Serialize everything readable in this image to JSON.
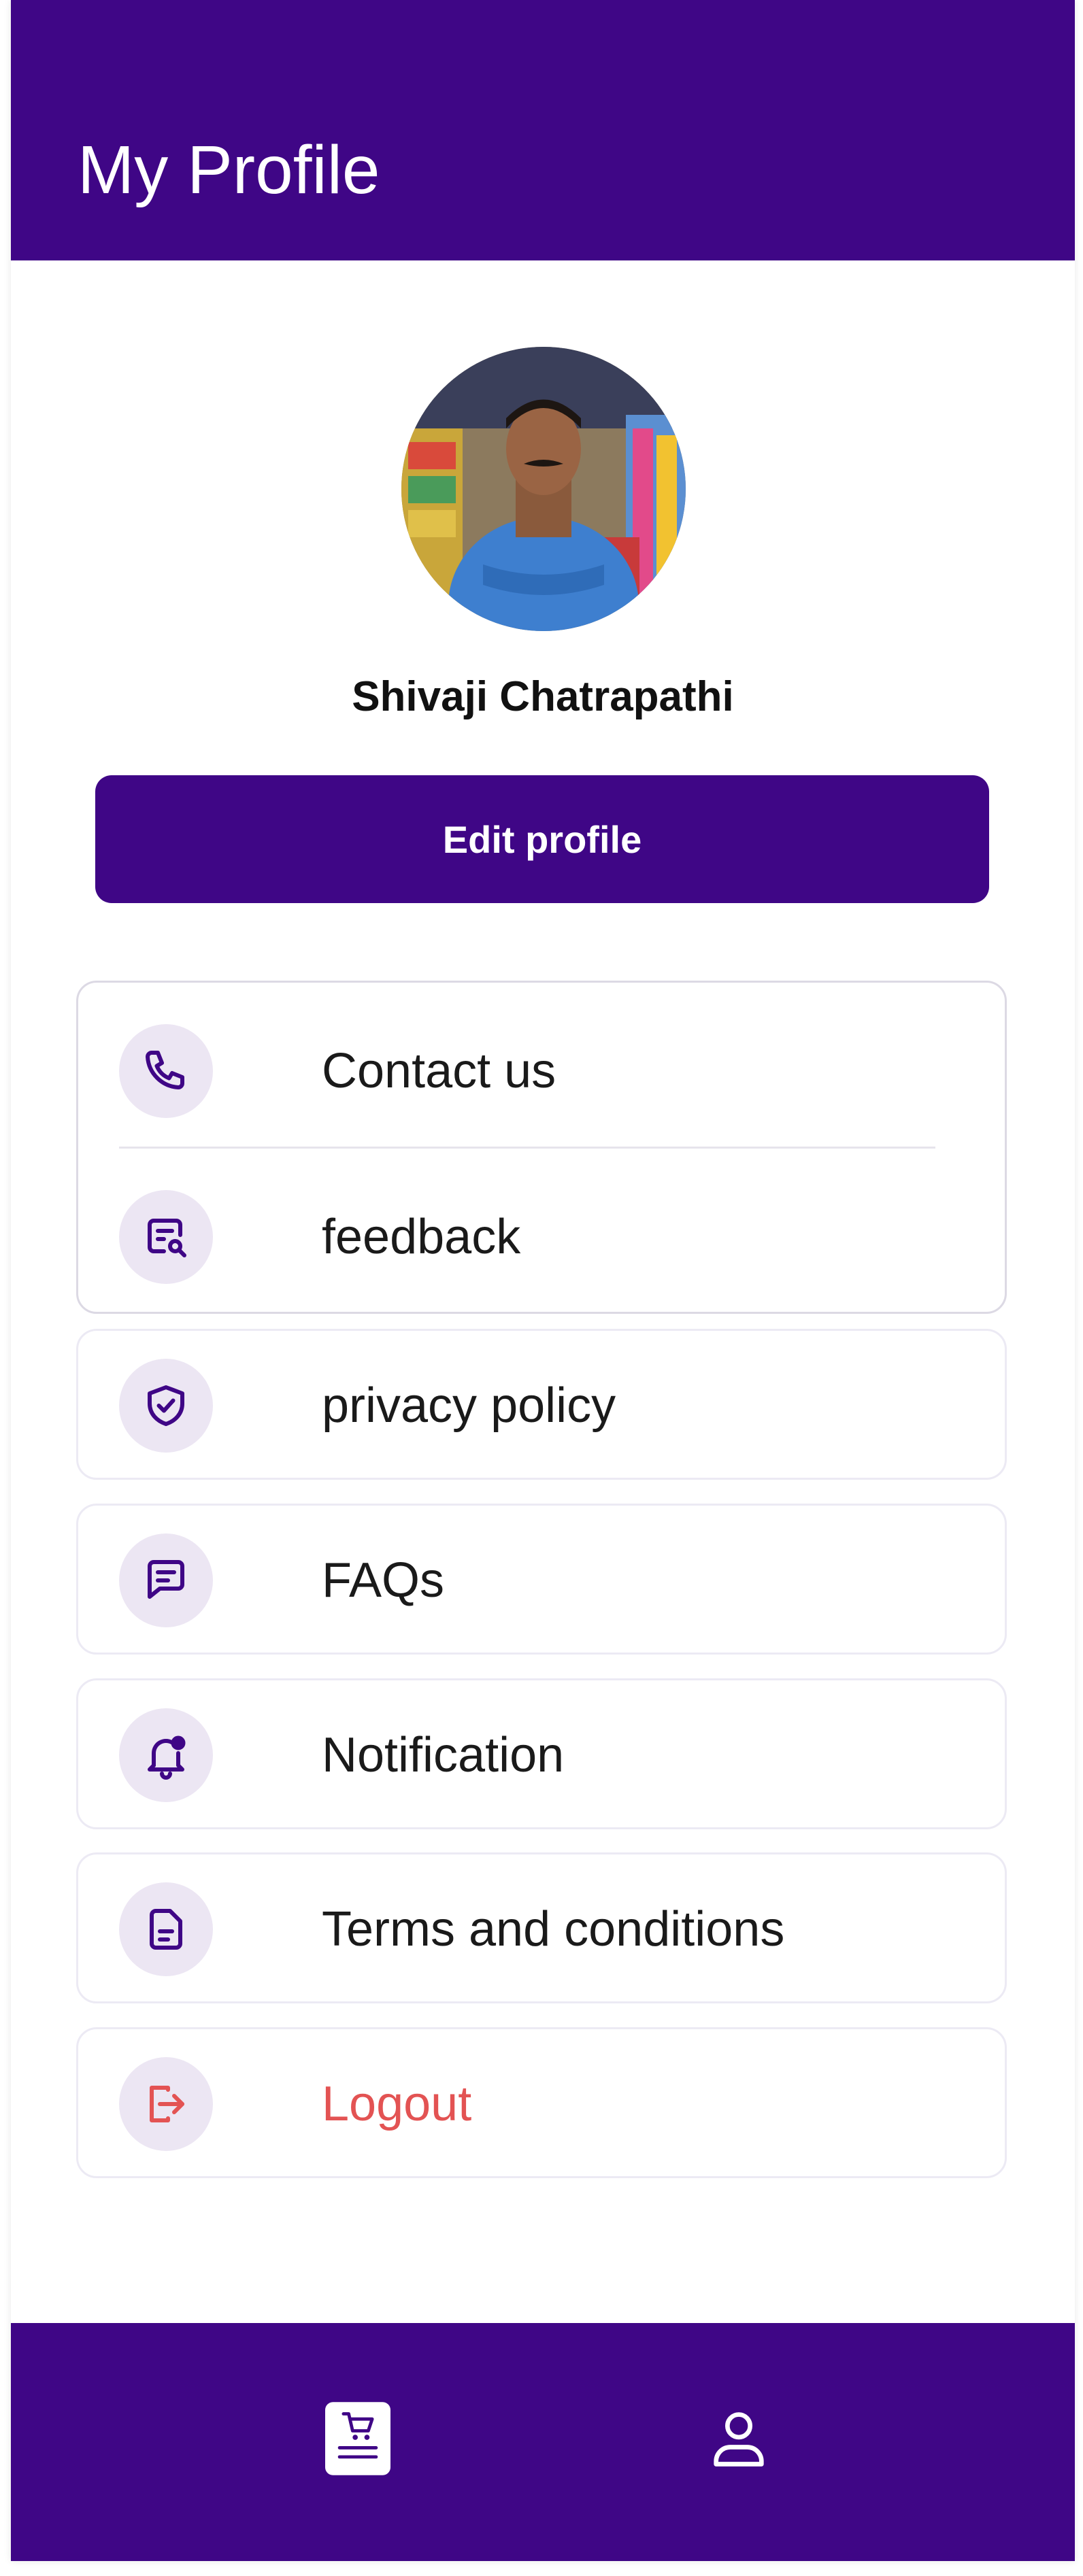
{
  "header": {
    "title": "My Profile"
  },
  "profile": {
    "name": "Shivaji Chatrapathi",
    "avatar_icon": "user-photo",
    "edit_label": "Edit profile"
  },
  "menu": {
    "contact": {
      "label": "Contact us",
      "icon": "phone-icon"
    },
    "feedback": {
      "label": "feedback",
      "icon": "feedback-search-icon"
    },
    "privacy": {
      "label": "privacy policy",
      "icon": "shield-check-icon"
    },
    "faqs": {
      "label": "FAQs",
      "icon": "chat-bubble-icon"
    },
    "notification": {
      "label": "Notification",
      "icon": "bell-icon"
    },
    "terms": {
      "label": "Terms and conditions",
      "icon": "document-icon"
    },
    "logout": {
      "label": "Logout",
      "icon": "logout-icon"
    }
  },
  "bottom_nav": [
    {
      "name": "orders",
      "icon": "cart-receipt-icon",
      "active": true
    },
    {
      "name": "profile",
      "icon": "user-icon",
      "active": false
    }
  ],
  "colors": {
    "primary": "#3f0686",
    "icon_bg": "#ece6f3",
    "logout": "#e35353",
    "text": "#1a1a1a"
  }
}
